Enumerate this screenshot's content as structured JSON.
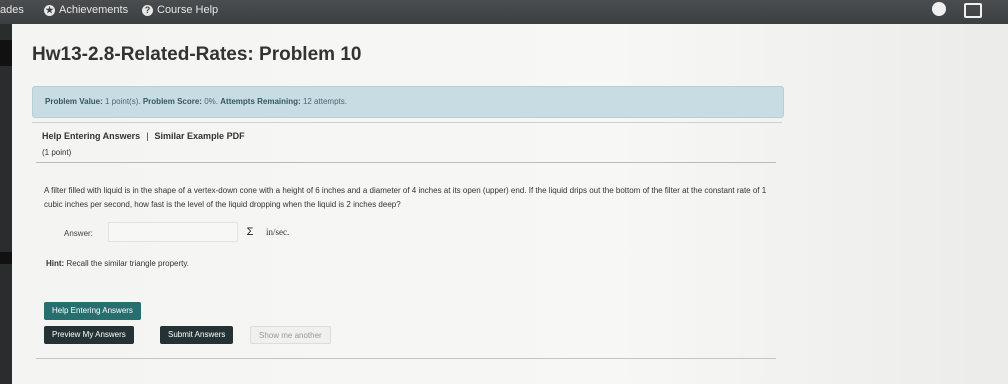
{
  "nav": {
    "grades_partial": "ades",
    "achievements": "Achievements",
    "course_help": "Course Help",
    "achievements_icon": "star-circle-icon",
    "course_help_icon": "question-circle-icon"
  },
  "page_title": "Hw13-2.8-Related-Rates: Problem 10",
  "info": {
    "problem_value_label": "Problem Value:",
    "problem_value": "1 point(s).",
    "problem_score_label": "Problem Score:",
    "problem_score": "0%.",
    "attempts_label": "Attempts Remaining:",
    "attempts": "12 attempts."
  },
  "links": {
    "help": "Help Entering Answers",
    "separator": "|",
    "similar": "Similar Example PDF"
  },
  "points": "(1 point)",
  "problem_text": "A filter filled with liquid is in the shape of a vertex-down cone with a height of 6 inches and a diameter of 4 inches at its open (upper) end. If the liquid drips out the bottom of the filter at the constant rate of 1 cubic inches per second, how fast is the level of the liquid dropping when the liquid is 2 inches deep?",
  "answer": {
    "label": "Answer:",
    "value": "",
    "equation_icon": "sigma-icon",
    "equation_symbol": "Σ",
    "units": "in/sec."
  },
  "hint": {
    "label": "Hint:",
    "text": "Recall the similar triangle property."
  },
  "buttons": {
    "help": "Help Entering Answers",
    "preview": "Preview My Answers",
    "submit": "Submit Answers",
    "another": "Show me another"
  }
}
